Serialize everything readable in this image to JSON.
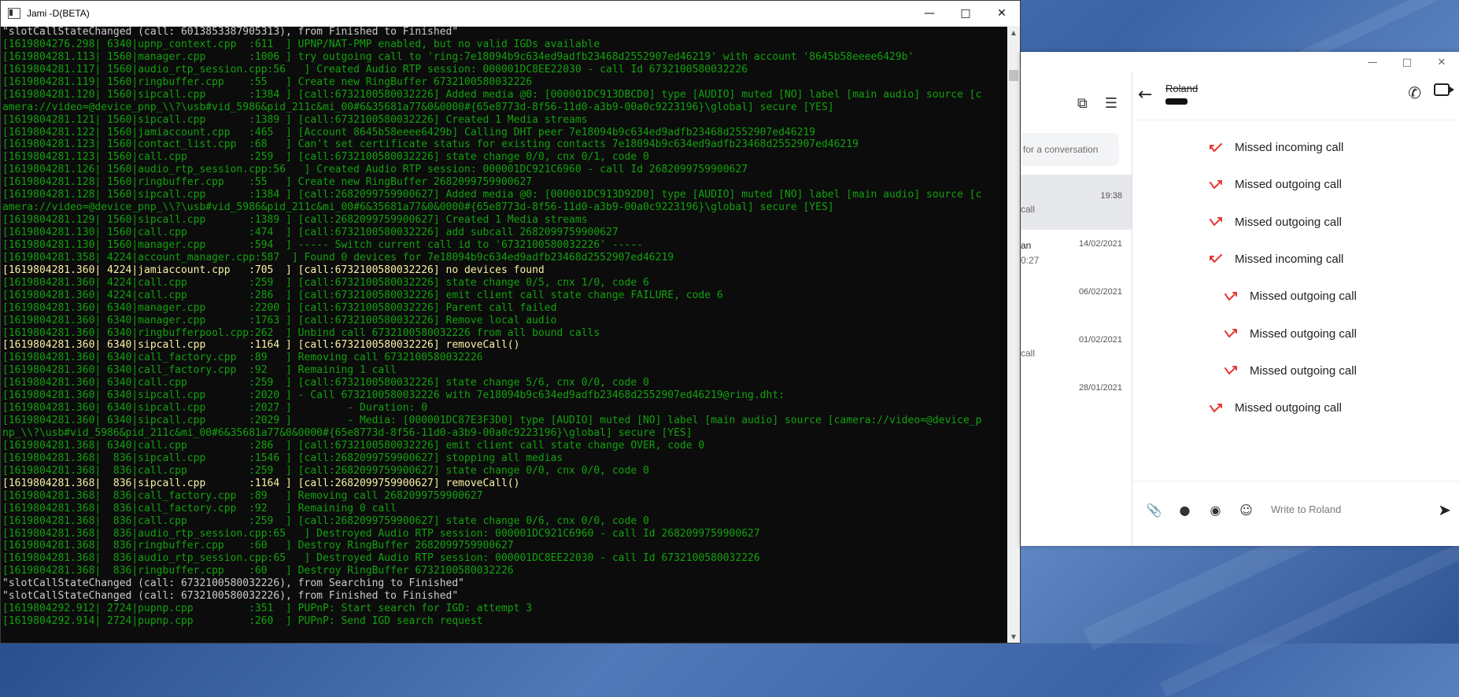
{
  "console": {
    "title": "Jami -D(BETA)",
    "lines": [
      {
        "t": "\"slotCallStateChanged (call: 6013853387905313), from Finished to Finished\"",
        "c": "w"
      },
      {
        "t": "[1619804276.298| 6340|upnp_context.cpp  :611  ] UPNP/NAT-PMP enabled, but no valid IGDs available",
        "c": "g"
      },
      {
        "t": "[1619804281.113| 1560|manager.cpp       :1006 ] try outgoing call to 'ring:7e18094b9c634ed9adfb23468d2552907ed46219' with account '8645b58eeee6429b'",
        "c": "g"
      },
      {
        "t": "[1619804281.117| 1560|audio_rtp_session.cpp:56   ] Created Audio RTP session: 000001DC8EE22030 - call Id 6732100580032226",
        "c": "g"
      },
      {
        "t": "[1619804281.119| 1560|ringbuffer.cpp    :55   ] Create new RingBuffer 6732100580032226",
        "c": "g"
      },
      {
        "t": "[1619804281.120| 1560|sipcall.cpp       :1384 ] [call:6732100580032226] Added media @0: [000001DC913DBCD0] type [AUDIO] muted [NO] label [main audio] source [c",
        "c": "g"
      },
      {
        "t": "amera://video=@device_pnp_\\\\?\\usb#vid_5986&pid_211c&mi_00#6&35681a77&0&0000#{65e8773d-8f56-11d0-a3b9-00a0c9223196}\\global] secure [YES]",
        "c": "g"
      },
      {
        "t": "[1619804281.121| 1560|sipcall.cpp       :1389 ] [call:6732100580032226] Created 1 Media streams",
        "c": "g"
      },
      {
        "t": "[1619804281.122| 1560|jamiaccount.cpp   :465  ] [Account 8645b58eeee6429b] Calling DHT peer 7e18094b9c634ed9adfb23468d2552907ed46219",
        "c": "g"
      },
      {
        "t": "[1619804281.123| 1560|contact_list.cpp  :68   ] Can't set certificate status for existing contacts 7e18094b9c634ed9adfb23468d2552907ed46219",
        "c": "g"
      },
      {
        "t": "[1619804281.123| 1560|call.cpp          :259  ] [call:6732100580032226] state change 0/0, cnx 0/1, code 0",
        "c": "g"
      },
      {
        "t": "[1619804281.126| 1560|audio_rtp_session.cpp:56   ] Created Audio RTP session: 000001DC921C6960 - call Id 2682099759900627",
        "c": "g"
      },
      {
        "t": "[1619804281.128| 1560|ringbuffer.cpp    :55   ] Create new RingBuffer 2682099759900627",
        "c": "g"
      },
      {
        "t": "[1619804281.128| 1560|sipcall.cpp       :1384 ] [call:2682099759900627] Added media @0: [000001DC913D92D0] type [AUDIO] muted [NO] label [main audio] source [c",
        "c": "g"
      },
      {
        "t": "amera://video=@device_pnp_\\\\?\\usb#vid_5986&pid_211c&mi_00#6&35681a77&0&0000#{65e8773d-8f56-11d0-a3b9-00a0c9223196}\\global] secure [YES]",
        "c": "g"
      },
      {
        "t": "[1619804281.129| 1560|sipcall.cpp       :1389 ] [call:2682099759900627] Created 1 Media streams",
        "c": "g"
      },
      {
        "t": "[1619804281.130| 1560|call.cpp          :474  ] [call:6732100580032226] add subcall 2682099759900627",
        "c": "g"
      },
      {
        "t": "[1619804281.130| 1560|manager.cpp       :594  ] ----- Switch current call id to '6732100580032226' -----",
        "c": "g"
      },
      {
        "t": "[1619804281.358| 4224|account_manager.cpp:587  ] Found 0 devices for 7e18094b9c634ed9adfb23468d2552907ed46219",
        "c": "g"
      },
      {
        "t": "[1619804281.360| 4224|jamiaccount.cpp   :705  ] [call:6732100580032226] no devices found",
        "c": "y"
      },
      {
        "t": "[1619804281.360| 4224|call.cpp          :259  ] [call:6732100580032226] state change 0/5, cnx 1/0, code 6",
        "c": "g"
      },
      {
        "t": "[1619804281.360| 4224|call.cpp          :286  ] [call:6732100580032226] emit client call state change FAILURE, code 6",
        "c": "g"
      },
      {
        "t": "[1619804281.360| 6340|manager.cpp       :2200 ] [call:6732100580032226] Parent call failed",
        "c": "g"
      },
      {
        "t": "[1619804281.360| 6340|manager.cpp       :1763 ] [call:6732100580032226] Remove local audio",
        "c": "g"
      },
      {
        "t": "[1619804281.360| 6340|ringbufferpool.cpp:262  ] Unbind call 6732100580032226 from all bound calls",
        "c": "g"
      },
      {
        "t": "[1619804281.360| 6340|sipcall.cpp       :1164 ] [call:6732100580032226] removeCall()",
        "c": "y"
      },
      {
        "t": "[1619804281.360| 6340|call_factory.cpp  :89   ] Removing call 6732100580032226",
        "c": "g"
      },
      {
        "t": "[1619804281.360| 6340|call_factory.cpp  :92   ] Remaining 1 call",
        "c": "g"
      },
      {
        "t": "[1619804281.360| 6340|call.cpp          :259  ] [call:6732100580032226] state change 5/6, cnx 0/0, code 0",
        "c": "g"
      },
      {
        "t": "[1619804281.360| 6340|sipcall.cpp       :2020 ] - Call 6732100580032226 with 7e18094b9c634ed9adfb23468d2552907ed46219@ring.dht:",
        "c": "g"
      },
      {
        "t": "[1619804281.360| 6340|sipcall.cpp       :2027 ]         - Duration: 0",
        "c": "g"
      },
      {
        "t": "[1619804281.360| 6340|sipcall.cpp       :2029 ]         - Media: [000001DC87E3F3D0] type [AUDIO] muted [NO] label [main audio] source [camera://video=@device_p",
        "c": "g"
      },
      {
        "t": "np_\\\\?\\usb#vid_5986&pid_211c&mi_00#6&35681a77&0&0000#{65e8773d-8f56-11d0-a3b9-00a0c9223196}\\global] secure [YES]",
        "c": "g"
      },
      {
        "t": "[1619804281.368| 6340|call.cpp          :286  ] [call:6732100580032226] emit client call state change OVER, code 0",
        "c": "g"
      },
      {
        "t": "[1619804281.368|  836|sipcall.cpp       :1546 ] [call:2682099759900627] stopping all medias",
        "c": "g"
      },
      {
        "t": "[1619804281.368|  836|call.cpp          :259  ] [call:2682099759900627] state change 0/0, cnx 0/0, code 0",
        "c": "g"
      },
      {
        "t": "[1619804281.368|  836|sipcall.cpp       :1164 ] [call:2682099759900627] removeCall()",
        "c": "y"
      },
      {
        "t": "[1619804281.368|  836|call_factory.cpp  :89   ] Removing call 2682099759900627",
        "c": "g"
      },
      {
        "t": "[1619804281.368|  836|call_factory.cpp  :92   ] Remaining 0 call",
        "c": "g"
      },
      {
        "t": "[1619804281.368|  836|call.cpp          :259  ] [call:2682099759900627] state change 0/6, cnx 0/0, code 0",
        "c": "g"
      },
      {
        "t": "[1619804281.368|  836|audio_rtp_session.cpp:65   ] Destroyed Audio RTP session: 000001DC921C6960 - call Id 2682099759900627",
        "c": "g"
      },
      {
        "t": "[1619804281.368|  836|ringbuffer.cpp    :60   ] Destroy RingBuffer 2682099759900627",
        "c": "g"
      },
      {
        "t": "[1619804281.368|  836|audio_rtp_session.cpp:65   ] Destroyed Audio RTP session: 000001DC8EE22030 - call Id 6732100580032226",
        "c": "g"
      },
      {
        "t": "[1619804281.368|  836|ringbuffer.cpp    :60   ] Destroy RingBuffer 6732100580032226",
        "c": "g"
      },
      {
        "t": "\"slotCallStateChanged (call: 6732100580032226), from Searching to Finished\"",
        "c": "w"
      },
      {
        "t": "\"slotCallStateChanged (call: 6732100580032226), from Finished to Finished\"",
        "c": "w"
      },
      {
        "t": "[1619804292.912| 2724|pupnp.cpp         :351  ] PUPnP: Start search for IGD: attempt 3",
        "c": "g"
      },
      {
        "t": "[1619804292.914| 2724|pupnp.cpp         :260  ] PUPnP: Send IGD search request",
        "c": "g"
      }
    ]
  },
  "jami": {
    "search_placeholder": "for a conversation",
    "conversations": [
      {
        "name": "",
        "sub": "call",
        "time": "19:38",
        "selected": true
      },
      {
        "name": "an",
        "sub": "0:27",
        "time": "14/02/2021",
        "selected": false
      },
      {
        "name": "",
        "sub": "",
        "time": "06/02/2021",
        "selected": false
      },
      {
        "name": "",
        "sub": "call",
        "time": "01/02/2021",
        "selected": false
      },
      {
        "name": "",
        "sub": "",
        "time": "28/01/2021",
        "selected": false
      }
    ],
    "contact_name": "Roland",
    "messages": [
      {
        "text": "Missed incoming call",
        "dir": "in"
      },
      {
        "text": "Missed outgoing call",
        "dir": "out"
      },
      {
        "text": "Missed outgoing call",
        "dir": "out"
      },
      {
        "text": "Missed incoming call",
        "dir": "in"
      },
      {
        "text": "Missed outgoing call",
        "dir": "out"
      },
      {
        "text": "Missed outgoing call",
        "dir": "out"
      },
      {
        "text": "Missed outgoing call",
        "dir": "out"
      },
      {
        "text": "Missed outgoing call",
        "dir": "out"
      }
    ],
    "input_placeholder": "Write to Roland",
    "missed_color": "#e53935"
  }
}
